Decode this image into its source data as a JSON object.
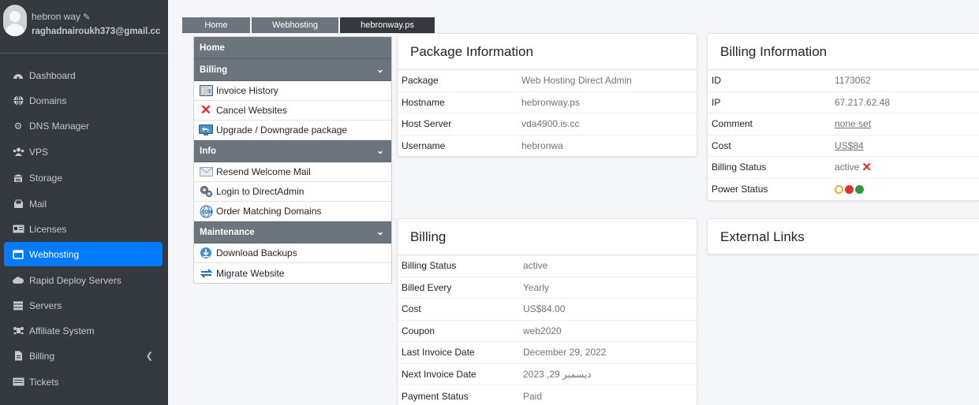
{
  "sidebar": {
    "user_name": "hebron way",
    "user_email": "raghadnairoukh373@gmail.cc",
    "items": [
      {
        "label": "Dashboard",
        "icon": "dashboard-icon"
      },
      {
        "label": "Domains",
        "icon": "globe-icon"
      },
      {
        "label": "DNS Manager",
        "icon": "gear-icon"
      },
      {
        "label": "VPS",
        "icon": "users-icon"
      },
      {
        "label": "Storage",
        "icon": "storage-icon"
      },
      {
        "label": "Mail",
        "icon": "mail-icon"
      },
      {
        "label": "Licenses",
        "icon": "license-icon"
      },
      {
        "label": "Webhosting",
        "icon": "window-icon"
      },
      {
        "label": "Rapid Deploy Servers",
        "icon": "cloud-icon"
      },
      {
        "label": "Servers",
        "icon": "server-icon"
      },
      {
        "label": "Affiliate System",
        "icon": "affiliate-icon"
      },
      {
        "label": "Billing",
        "icon": "invoice-icon"
      },
      {
        "label": "Tickets",
        "icon": "ticket-icon"
      }
    ]
  },
  "breadcrumb": [
    "Home",
    "Webhosting",
    "hebronway.ps"
  ],
  "menu": {
    "home": "Home",
    "billing_head": "Billing",
    "billing_items": [
      "Invoice History",
      "Cancel Websites",
      "Upgrade / Downgrade package"
    ],
    "info_head": "Info",
    "info_items": [
      "Resend Welcome Mail",
      "Login to DirectAdmin",
      "Order Matching Domains"
    ],
    "maint_head": "Maintenance",
    "maint_items": [
      "Download Backups",
      "Migrate Website"
    ]
  },
  "package": {
    "title": "Package Information",
    "rows": [
      {
        "k": "Package",
        "v": "Web Hosting Direct Admin"
      },
      {
        "k": "Hostname",
        "v": "hebronway.ps"
      },
      {
        "k": "Host Server",
        "v": "vda4900.is.cc"
      },
      {
        "k": "Username",
        "v": "hebronwa"
      }
    ]
  },
  "billing_info": {
    "title": "Billing Information",
    "rows": [
      {
        "k": "ID",
        "v": "1173062"
      },
      {
        "k": "IP",
        "v": "67.217.62.48"
      },
      {
        "k": "Comment",
        "v": "none set"
      },
      {
        "k": "Cost",
        "v": "US$84"
      },
      {
        "k": "Billing Status",
        "v": "active"
      },
      {
        "k": "Power Status",
        "v": ""
      }
    ]
  },
  "billing": {
    "title": "Billing",
    "rows": [
      {
        "k": "Billing Status",
        "v": "active"
      },
      {
        "k": "Billed Every",
        "v": "Yearly"
      },
      {
        "k": "Cost",
        "v": "US$84.00"
      },
      {
        "k": "Coupon",
        "v": "web2020"
      },
      {
        "k": "Last Invoice Date",
        "v": "December 29, 2022"
      },
      {
        "k": "Next Invoice Date",
        "v": "ديسمبر 29, 2023"
      },
      {
        "k": "Payment Status",
        "v": "Paid"
      }
    ]
  },
  "external": {
    "title": "External Links"
  },
  "colors": {
    "sidebar_bg": "#343a40",
    "active": "#007bff",
    "danger": "#e3262a"
  }
}
